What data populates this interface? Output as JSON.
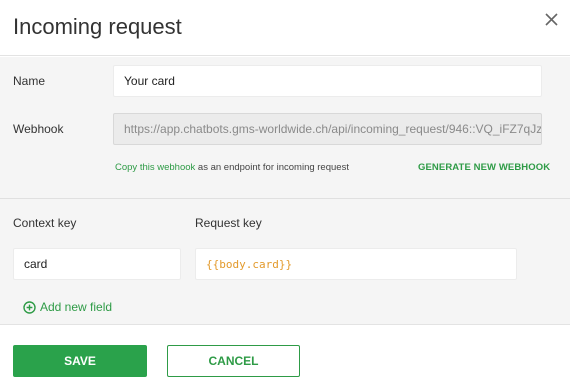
{
  "dialog": {
    "title": "Incoming request"
  },
  "form": {
    "name_label": "Name",
    "name_value": "Your card",
    "webhook_label": "Webhook",
    "webhook_value": "https://app.chatbots.gms-worldwide.ch/api/incoming_request/946::VQ_iFZ7qJz",
    "hint_link": "Copy this webhook",
    "hint_text": " as an endpoint for incoming request",
    "generate_label": "GENERATE NEW WEBHOOK",
    "context_key_label": "Context key",
    "request_key_label": "Request key",
    "context_key_value": "card",
    "request_key_value": "{{body.card}}",
    "add_field_label": "Add new field"
  },
  "footer": {
    "save_label": "SAVE",
    "cancel_label": "CANCEL"
  },
  "colors": {
    "accent": "#2aa24b",
    "template_value": "#e39a2c"
  },
  "icons": {
    "close": "close-icon",
    "add": "plus-circle-icon"
  }
}
